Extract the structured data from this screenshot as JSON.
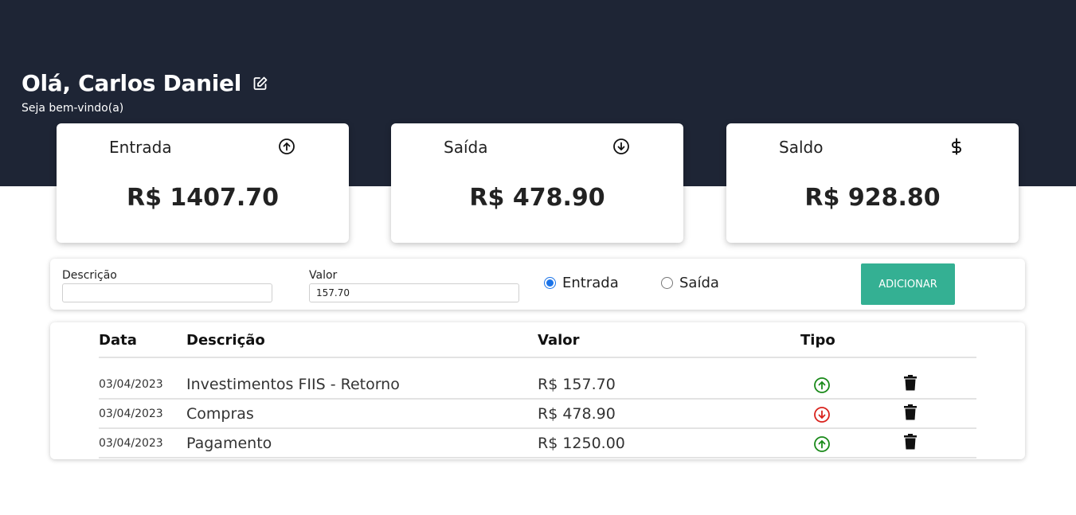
{
  "header": {
    "greeting": "Olá, Carlos Daniel",
    "welcome": "Seja bem-vindo(a)",
    "edit_icon": "edit-icon"
  },
  "cards": [
    {
      "label": "Entrada",
      "value": "R$ 1407.70",
      "icon": "arrow-up-circle-icon"
    },
    {
      "label": "Saída",
      "value": "R$ 478.90",
      "icon": "arrow-down-circle-icon"
    },
    {
      "label": "Saldo",
      "value": "R$ 928.80",
      "icon": "dollar-icon"
    }
  ],
  "form": {
    "description_label": "Descrição",
    "description_value": "",
    "value_label": "Valor",
    "value_value": "157.70",
    "radio_entrada": "Entrada",
    "radio_saida": "Saída",
    "selected": "Entrada",
    "add_label": "ADICIONAR"
  },
  "table": {
    "headers": {
      "date": "Data",
      "description": "Descrição",
      "value": "Valor",
      "type": "Tipo"
    },
    "rows": [
      {
        "date": "03/04/2023",
        "description": "Investimentos FIIS - Retorno",
        "value": "R$ 157.70",
        "type": "entrada"
      },
      {
        "date": "03/04/2023",
        "description": "Compras",
        "value": "R$ 478.90",
        "type": "saida"
      },
      {
        "date": "03/04/2023",
        "description": "Pagamento",
        "value": "R$ 1250.00",
        "type": "entrada"
      }
    ]
  },
  "colors": {
    "hero_bg": "#1e2535",
    "accent": "#34b093",
    "entrada": "#1a8a1a",
    "saida": "#d9231d"
  }
}
